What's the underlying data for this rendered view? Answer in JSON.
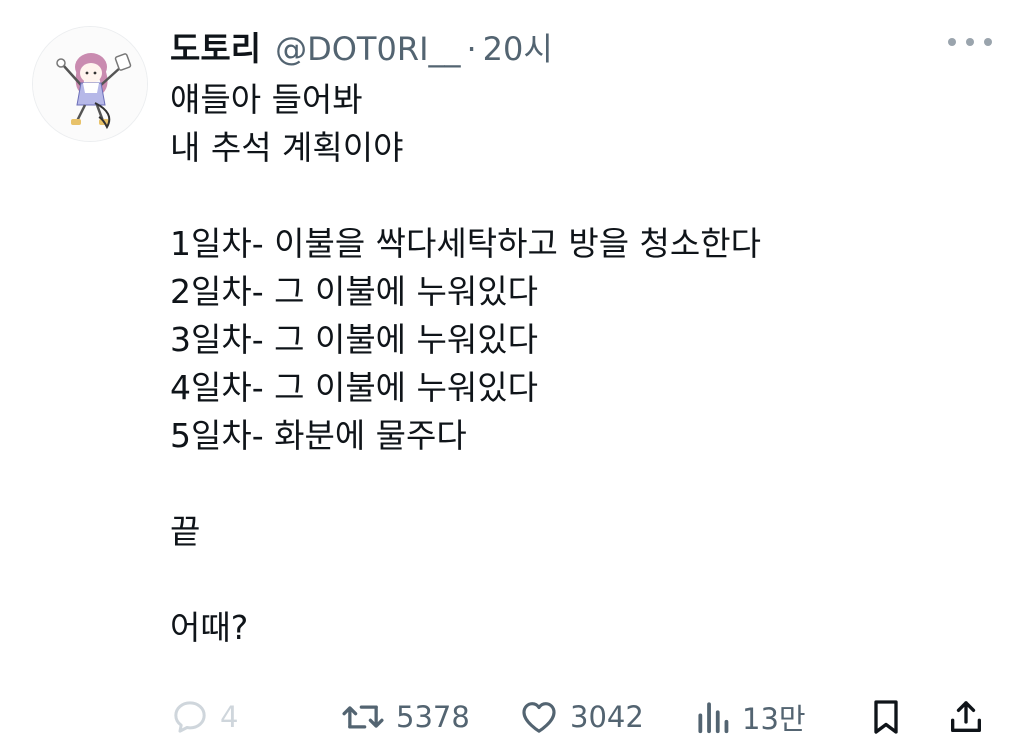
{
  "tweet": {
    "author_name": "도토리",
    "author_handle": "@DOT0RI__",
    "separator": "·",
    "time": "20시",
    "lines": [
      "얘들아 들어봐",
      "내 추석 계획이야",
      "",
      "1일차- 이불을 싹다세탁하고 방을 청소한다",
      "2일차- 그 이불에 누워있다",
      "3일차- 그 이불에 누워있다",
      "4일차- 그 이불에 누워있다",
      "5일차- 화분에 물주다",
      "",
      "끝",
      "",
      "어때?"
    ]
  },
  "actions": {
    "reply": {
      "icon": "reply-icon",
      "count": "4"
    },
    "retweet": {
      "icon": "retweet-icon",
      "count": "5378"
    },
    "like": {
      "icon": "heart-icon",
      "count": "3042"
    },
    "views": {
      "icon": "views-icon",
      "count": "13만"
    },
    "bookmark": {
      "icon": "bookmark-icon"
    },
    "share": {
      "icon": "share-icon"
    }
  },
  "colors": {
    "text": "#0f1419",
    "secondary": "#536471",
    "faded_reply": "#cfd6dc"
  }
}
